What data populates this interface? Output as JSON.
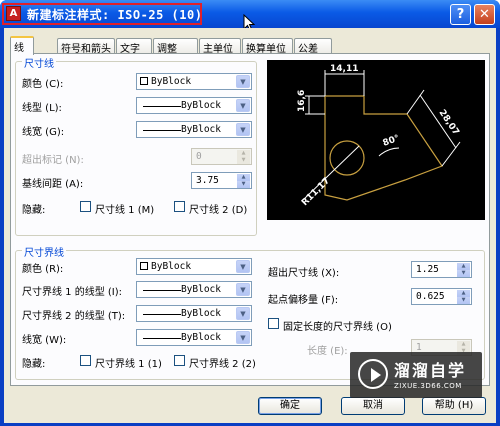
{
  "window": {
    "title": "新建标注样式: ISO-25 (10)",
    "help_glyph": "?",
    "close_glyph": "✕",
    "icon_glyph": "A"
  },
  "tabs": [
    {
      "label": "线",
      "active": true
    },
    {
      "label": "符号和箭头"
    },
    {
      "label": "文字"
    },
    {
      "label": "调整"
    },
    {
      "label": "主单位"
    },
    {
      "label": "换算单位"
    },
    {
      "label": "公差"
    }
  ],
  "dim_lines": {
    "title": "尺寸线",
    "color_label": "颜色 (C):",
    "color_value": "ByBlock",
    "linetype_label": "线型 (L):",
    "linetype_value": "ByBlock",
    "lineweight_label": "线宽 (G):",
    "lineweight_value": "ByBlock",
    "extend_ticks_label": "超出标记 (N):",
    "extend_ticks_value": "0",
    "baseline_spacing_label": "基线间距 (A):",
    "baseline_spacing_value": "3.75",
    "suppress_label": "隐藏:",
    "suppress_1_label": "尺寸线 1 (M)",
    "suppress_2_label": "尺寸线 2 (D)"
  },
  "ext_lines": {
    "title": "尺寸界线",
    "color_label": "颜色 (R):",
    "color_value": "ByBlock",
    "linetype1_label": "尺寸界线 1 的线型 (I):",
    "linetype1_value": "ByBlock",
    "linetype2_label": "尺寸界线 2 的线型 (T):",
    "linetype2_value": "ByBlock",
    "lineweight_label": "线宽 (W):",
    "lineweight_value": "ByBlock",
    "suppress_label": "隐藏:",
    "suppress_1_label": "尺寸界线 1 (1)",
    "suppress_2_label": "尺寸界线 2 (2)",
    "extend_beyond_label": "超出尺寸线 (X):",
    "extend_beyond_value": "1.25",
    "offset_label": "起点偏移量 (F):",
    "offset_value": "0.625",
    "fixed_length_label": "固定长度的尺寸界线 (O)",
    "length_label": "长度 (E):",
    "length_value": "1"
  },
  "preview": {
    "dim_top": "14,11",
    "dim_left": "16,6",
    "dim_right": "28,07",
    "angle": "80°",
    "radius": "R11,17"
  },
  "buttons": {
    "ok": "确定",
    "cancel": "取消",
    "help": "帮助 (H)"
  },
  "watermark": {
    "name": "溜溜自学",
    "url": "ZIXUE.3D66.COM"
  },
  "colors": {
    "title_start": "#3b8cf5",
    "title_end": "#0846cf",
    "group_title": "#0046d5",
    "preview_bg": "#000000",
    "preview_lines": "#c8a040"
  }
}
